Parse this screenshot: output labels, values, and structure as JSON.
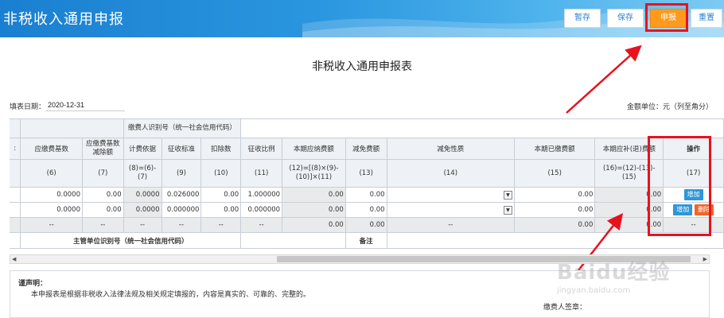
{
  "header": {
    "title": "非税收入通用申报",
    "buttons": {
      "save_draft": "暂存",
      "save": "保存",
      "submit": "申报",
      "reset": "重置"
    }
  },
  "form": {
    "title": "非税收入通用申报表",
    "date_label": "填表日期：",
    "date_value": "2020-12-31",
    "unit_label": "金额单位：元（列至角分）"
  },
  "table": {
    "payer_id_label": "缴费人识别号（统一社会信用代码）",
    "headers": {
      "h6": "应缴费基数",
      "h7": "应缴费基数减除额",
      "h8": "计费依据",
      "h9": "征收标准",
      "h10": "扣除数",
      "h11": "征收比例",
      "h12": "本期应纳费额",
      "h13": "减免费额",
      "h14": "减免性质",
      "h15": "本期已缴费额",
      "h16": "本期应补(退)费额",
      "h17": "操作"
    },
    "formulas": {
      "f6": "(6)",
      "f7": "(7)",
      "f8": "(8)=(6)-(7)",
      "f9": "(9)",
      "f10": "(10)",
      "f11": "(11)",
      "f12": "(12)=[(8)×(9)-(10)]×(11)",
      "f13": "(13)",
      "f14": "(14)",
      "f15": "(15)",
      "f16": "(16)=(12)-(13)-(15)",
      "f17": "(17)"
    },
    "rows": [
      {
        "c6": "0.0000",
        "c7": "0.00",
        "c8": "0.0000",
        "c9": "0.026000",
        "c10": "0.00",
        "c11": "1.000000",
        "c12": "0.00",
        "c13": "0.00",
        "c15": "0.00",
        "c16": "0.00",
        "add": "增加"
      },
      {
        "c6": "0.0000",
        "c7": "0.00",
        "c8": "0.0000",
        "c9": "0.000000",
        "c10": "0.00",
        "c11": "0.000000",
        "c12": "0.00",
        "c13": "0.00",
        "c15": "0.00",
        "c16": "0.00",
        "add": "增加",
        "del": "删除"
      }
    ],
    "total_row": {
      "c6": "--",
      "c7": "--",
      "c8": "--",
      "c9": "--",
      "c10": "--",
      "c11": "--",
      "c12": "0.00",
      "c13": "0.00",
      "c14": "--",
      "c15": "0.00",
      "c16": "0.00",
      "c17": "--"
    },
    "supervisor_label": "主管单位识别号（统一社会信用代码）",
    "remark_label": "备注"
  },
  "declaration": {
    "title": "谨声明：",
    "text": "本申报表是根据非税收入法律法规及相关规定填报的，内容是真实的、可靠的、完整的。",
    "signature_label": "缴费人签章："
  },
  "watermark": {
    "main": "Baidu经验",
    "sub": "jingyan.baidu.com"
  },
  "colors": {
    "header": "#2b97e0",
    "submit": "#ff9a1f",
    "highlight": "#e8121d",
    "add_button": "#2f96d9",
    "delete_button": "#f2642b"
  }
}
